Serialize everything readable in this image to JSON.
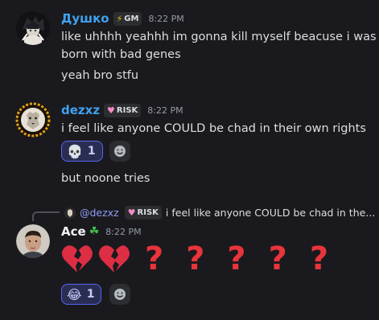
{
  "messages": [
    {
      "username": "Душко",
      "username_color": "#3fa2f0",
      "tag": "GM",
      "time": "8:22 PM",
      "lines": [
        "like uhhhh yeahhh im gonna kill myself beacuse i was",
        "born with bad genes",
        "yeah bro stfu"
      ]
    },
    {
      "username": "dezxz",
      "username_color": "#3fa2f0",
      "tag": "RISK",
      "time": "8:22 PM",
      "lines": [
        "i feel like anyone COULD be chad in their own rights"
      ],
      "reaction": {
        "emoji": "skull",
        "count": "1"
      },
      "followup": "but noone tries"
    },
    {
      "username": "Ace",
      "username_color": "#f2f3f5",
      "time": "8:22 PM",
      "reply": {
        "mention": "@dezxz",
        "tag": "RISK",
        "preview": "i feel like anyone COULD be chad in the..."
      },
      "big_emojis": [
        "broken-heart",
        "broken-heart",
        "?",
        "?",
        "?",
        "?",
        "?"
      ],
      "reaction": {
        "emoji": "joy",
        "count": "1"
      }
    }
  ],
  "colors": {
    "accent": "#5865f2",
    "background": "#1a1a1e",
    "qmark": "#e8343b"
  }
}
